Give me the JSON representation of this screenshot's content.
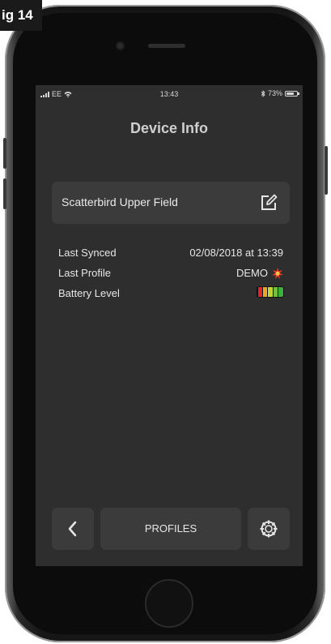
{
  "figure_label": "ig 14",
  "status_bar": {
    "carrier": "EE",
    "time": "13:43",
    "battery_percent": "73%"
  },
  "screen": {
    "title": "Device Info",
    "device_name": "Scatterbird Upper Field",
    "edit_icon": "edit-icon"
  },
  "info": {
    "last_synced_label": "Last Synced",
    "last_synced_value": "02/08/2018 at 13:39",
    "last_profile_label": "Last Profile",
    "last_profile_value": "DEMO",
    "battery_label": "Battery Level",
    "battery_segments": [
      "#e0262b",
      "#e8a62b",
      "#c3d237",
      "#72c03a",
      "#3cb13a"
    ]
  },
  "toolbar": {
    "back_icon": "chevron-left-icon",
    "profiles_label": "PROFILES",
    "settings_icon": "gear-icon"
  },
  "colors": {
    "screen_bg": "#2e2e2e",
    "card_bg": "#3b3b3b",
    "text": "#e6e6e6"
  }
}
